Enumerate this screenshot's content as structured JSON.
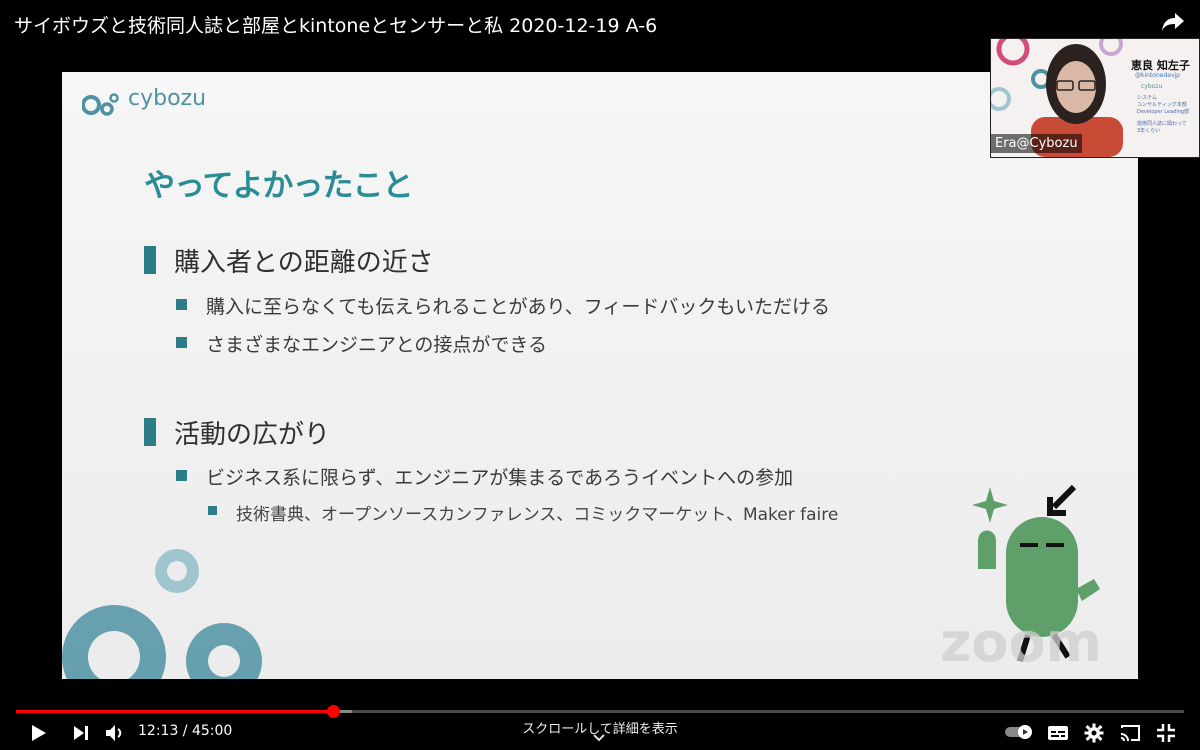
{
  "video": {
    "title": "サイボウズと技術同人誌と部屋とkintoneとセンサーと私 2020-12-19 A-6"
  },
  "slide": {
    "logo": "cybozu",
    "heading": "やってよかったこと",
    "sections": [
      {
        "title": "購入者との距離の近さ",
        "bullets": [
          "購入に至らなくても伝えられることがあり、フィードバックもいただける",
          "さまざまなエンジニアとの接点ができる"
        ]
      },
      {
        "title": "活動の広がり",
        "bullets": [
          "ビジネス系に限らず、エンジニアが集まるであろうイベントへの参加"
        ],
        "sub_bullets": [
          "技術書典、オープンソースカンファレンス、コミックマーケット、Maker faire"
        ]
      }
    ],
    "watermark": "zoom"
  },
  "webcam": {
    "name": "恵良 知左子",
    "handle": "@kintonedevjp",
    "logo": "cybozu",
    "desc_lines": [
      "システム",
      "コンサルティング本部",
      "Developer Leading部",
      "技術同人誌に関わって",
      "3年くらい"
    ],
    "label": "Era@Cybozu"
  },
  "player": {
    "current_time": "12:13",
    "duration": "45:00",
    "time_display": "12:13 / 45:00",
    "progress_fraction": 0.271,
    "buffer_fraction": 0.288,
    "scroll_hint": "スクロールして詳細を表示",
    "accent_color": "#ff0000"
  },
  "icons": {
    "share": "share-icon",
    "play": "play-icon",
    "next": "next-icon",
    "volume": "volume-icon",
    "autoplay": "autoplay-toggle-icon",
    "subtitles": "subtitles-icon",
    "settings": "gear-icon",
    "cast": "cast-icon",
    "exit_fullscreen": "exit-fullscreen-icon"
  },
  "colors": {
    "slide_heading": "#2a8d96",
    "bullet": "#2d7d88",
    "mascot_green": "#5fa06a"
  }
}
